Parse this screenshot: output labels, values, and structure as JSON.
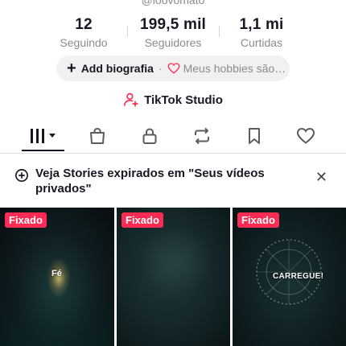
{
  "profile": {
    "handle": "@loovomato"
  },
  "stats": [
    {
      "value": "12",
      "label": "Seguindo"
    },
    {
      "value": "199,5 mil",
      "label": "Seguidores"
    },
    {
      "value": "1,1 mi",
      "label": "Curtidas"
    }
  ],
  "bio": {
    "add_label": "Add biografia",
    "separator": "·",
    "hobbies": "Meus hobbies são…"
  },
  "studio": {
    "label": "TikTok Studio"
  },
  "tabs": [
    {
      "name": "videos",
      "icon": "grid-icon"
    },
    {
      "name": "shop",
      "icon": "bag-icon"
    },
    {
      "name": "private",
      "icon": "lock-icon"
    },
    {
      "name": "reposts",
      "icon": "repost-icon"
    },
    {
      "name": "favorites",
      "icon": "bookmark-icon"
    },
    {
      "name": "liked",
      "icon": "heart-icon"
    }
  ],
  "notice": {
    "text": "Veja Stories expirados em \"Seus vídeos privados\"",
    "close": "✕"
  },
  "videos": [
    {
      "badge": "Fixado",
      "overlay": "Fé"
    },
    {
      "badge": "Fixado",
      "overlay": ""
    },
    {
      "badge": "Fixado",
      "overlay": "CARREGUE!"
    }
  ],
  "colors": {
    "accent": "#fe2c55",
    "muted": "#8a8b91",
    "text": "#161823"
  }
}
